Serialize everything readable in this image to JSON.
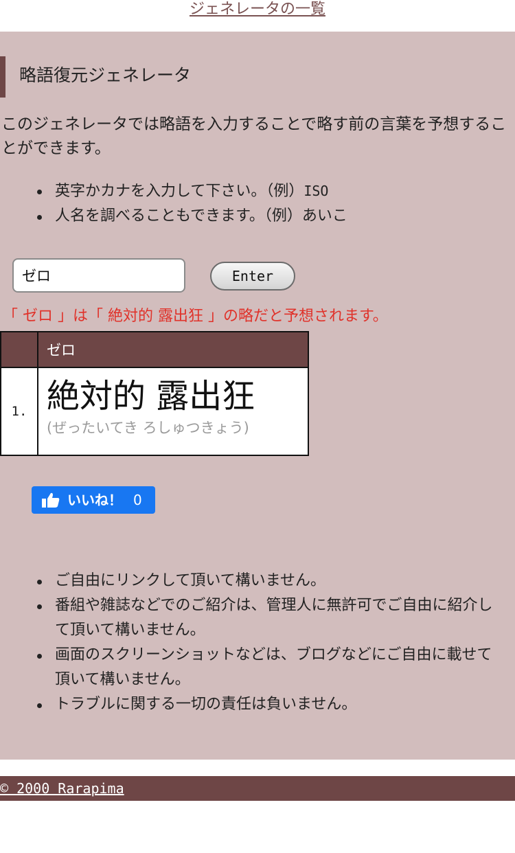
{
  "top": {
    "list_link": "ジェネレータの一覧"
  },
  "heading": {
    "title": "略語復元ジェネレータ"
  },
  "intro": {
    "text": "このジェネレータでは略語を入力することで略す前の言葉を予想することができます。"
  },
  "tips": [
    {
      "text": "英字かカナを入力して下さい。（例）",
      "example": "ISO"
    },
    {
      "text": "人名を調べることもできます。（例）あいこ",
      "example": ""
    }
  ],
  "form": {
    "input_value": "ゼロ",
    "enter_label": "Enter"
  },
  "result": {
    "text": "「 ゼロ 」は「 絶対的 露出狂 」の略だと予想されます。"
  },
  "table": {
    "header_word": "ゼロ",
    "rows": [
      {
        "num": "1.",
        "word": "絶対的 露出狂",
        "reading": "(ぜったいてき ろしゅつきょう)"
      }
    ]
  },
  "like": {
    "label": "いいね！",
    "count": "0",
    "icon": "thumbs-up-icon"
  },
  "notes": [
    "ご自由にリンクして頂いて構いません。",
    "番組や雑誌などでのご紹介は、管理人に無許可でご自由に紹介して頂いて構いません。",
    "画面のスクリーンショットなどは、ブログなどにご自由に載せて頂いて構いません。",
    "トラブルに関する一切の責任は負いません。"
  ],
  "footer": {
    "copyright": "© 2000 Rarapima"
  },
  "colors": {
    "background": "#d2bdbd",
    "accent": "#6e4646",
    "result_text": "#e0322a",
    "like_button": "#1877f2"
  }
}
